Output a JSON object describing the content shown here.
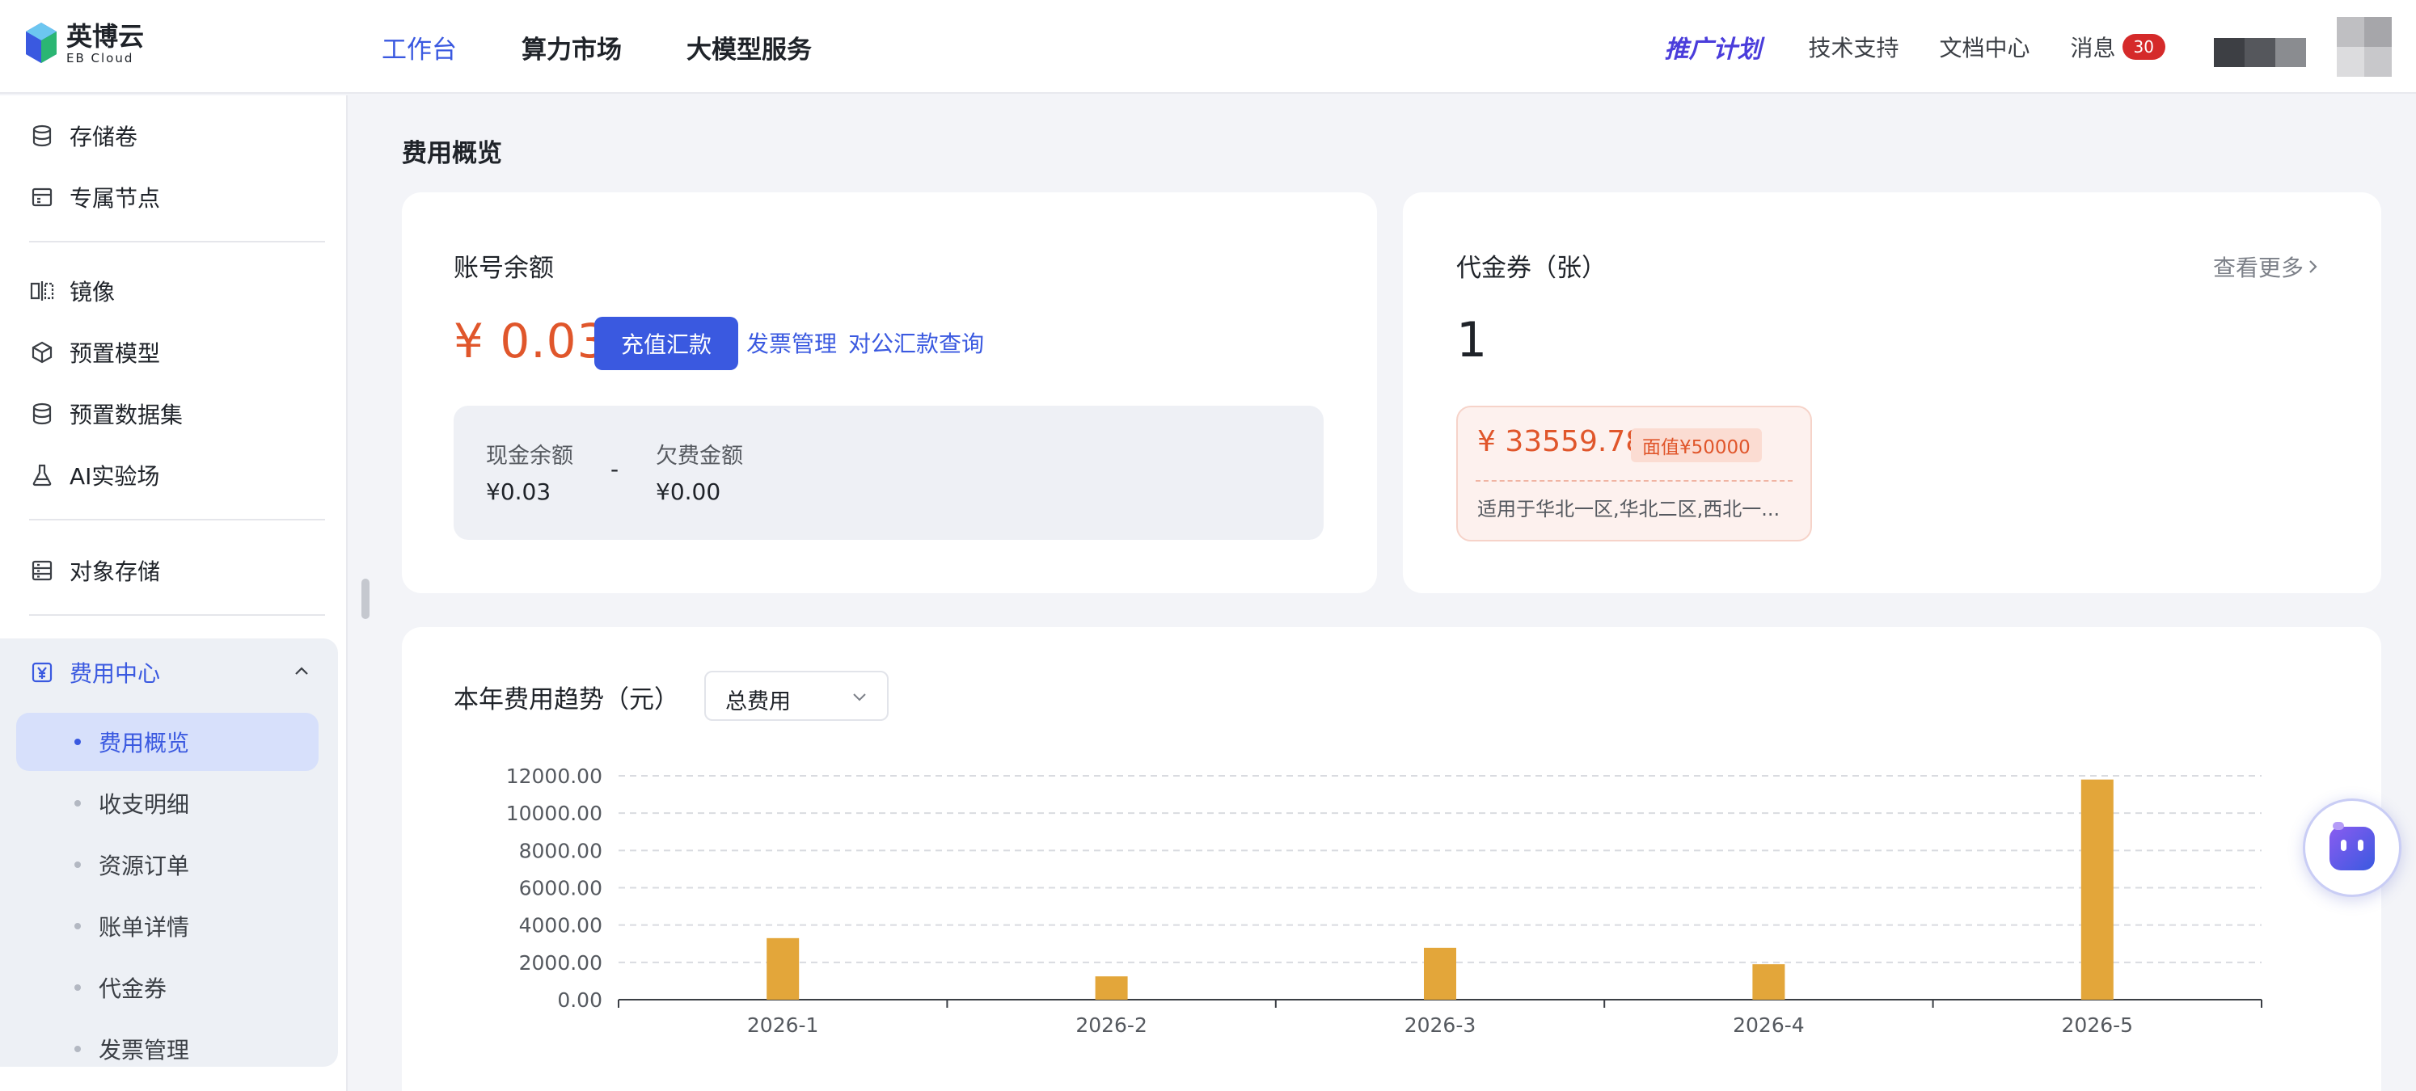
{
  "brand": {
    "name_cn": "英博云",
    "name_en": "EB Cloud"
  },
  "topnav": [
    {
      "label": "工作台",
      "active": true
    },
    {
      "label": "算力市场",
      "active": false
    },
    {
      "label": "大模型服务",
      "active": false
    }
  ],
  "header": {
    "promo": "推广计划",
    "links": [
      "技术支持",
      "文档中心"
    ],
    "messages": {
      "label": "消息",
      "count": "30"
    }
  },
  "sidebar": {
    "items": [
      {
        "label": "存储卷",
        "icon": "database-icon"
      },
      {
        "label": "专属节点",
        "icon": "server-node-icon"
      },
      {
        "label": "镜像",
        "icon": "mirror-image-icon"
      },
      {
        "label": "预置模型",
        "icon": "cube-icon"
      },
      {
        "label": "预置数据集",
        "icon": "database-icon"
      },
      {
        "label": "AI实验场",
        "icon": "flask-icon"
      },
      {
        "label": "对象存储",
        "icon": "object-storage-icon"
      }
    ],
    "billing": {
      "label": "费用中心",
      "icon": "yuan-icon",
      "children": [
        {
          "label": "费用概览",
          "active": true
        },
        {
          "label": "收支明细",
          "active": false
        },
        {
          "label": "资源订单",
          "active": false
        },
        {
          "label": "账单详情",
          "active": false
        },
        {
          "label": "代金券",
          "active": false
        },
        {
          "label": "发票管理",
          "active": false
        }
      ]
    }
  },
  "main": {
    "title": "费用概览",
    "balance": {
      "title": "账号余额",
      "amount": "¥ 0.03",
      "recharge_button": "充值汇款",
      "invoice_link": "发票管理",
      "transfer_link": "对公汇款查询",
      "cash_label": "现金余额",
      "cash_value": "¥0.03",
      "separator": "-",
      "debt_label": "欠费金额",
      "debt_value": "¥0.00"
    },
    "voucher": {
      "title": "代金券（张）",
      "more_link": "查看更多",
      "count": "1",
      "coupon_amount": "¥ 33559.78",
      "coupon_face": "面值¥50000",
      "coupon_desc": "适用于华北一区,华北二区,西北一..."
    },
    "trend": {
      "title": "本年费用趋势（元）",
      "select_value": "总费用"
    }
  },
  "colors": {
    "accent": "#3a59e0",
    "amount": "#e0562b",
    "bar": "#e3a63a",
    "badge": "#d52a2a"
  },
  "chart_data": {
    "type": "bar",
    "categories": [
      "2026-1",
      "2026-2",
      "2026-3",
      "2026-4",
      "2026-5"
    ],
    "values": [
      3300,
      1250,
      2780,
      1900,
      11800
    ],
    "ylim": [
      0,
      12000
    ],
    "yticks": [
      "0.00",
      "2000.00",
      "4000.00",
      "6000.00",
      "8000.00",
      "10000.00",
      "12000.00"
    ],
    "grid": true,
    "title": "",
    "xlabel": "",
    "ylabel": ""
  }
}
